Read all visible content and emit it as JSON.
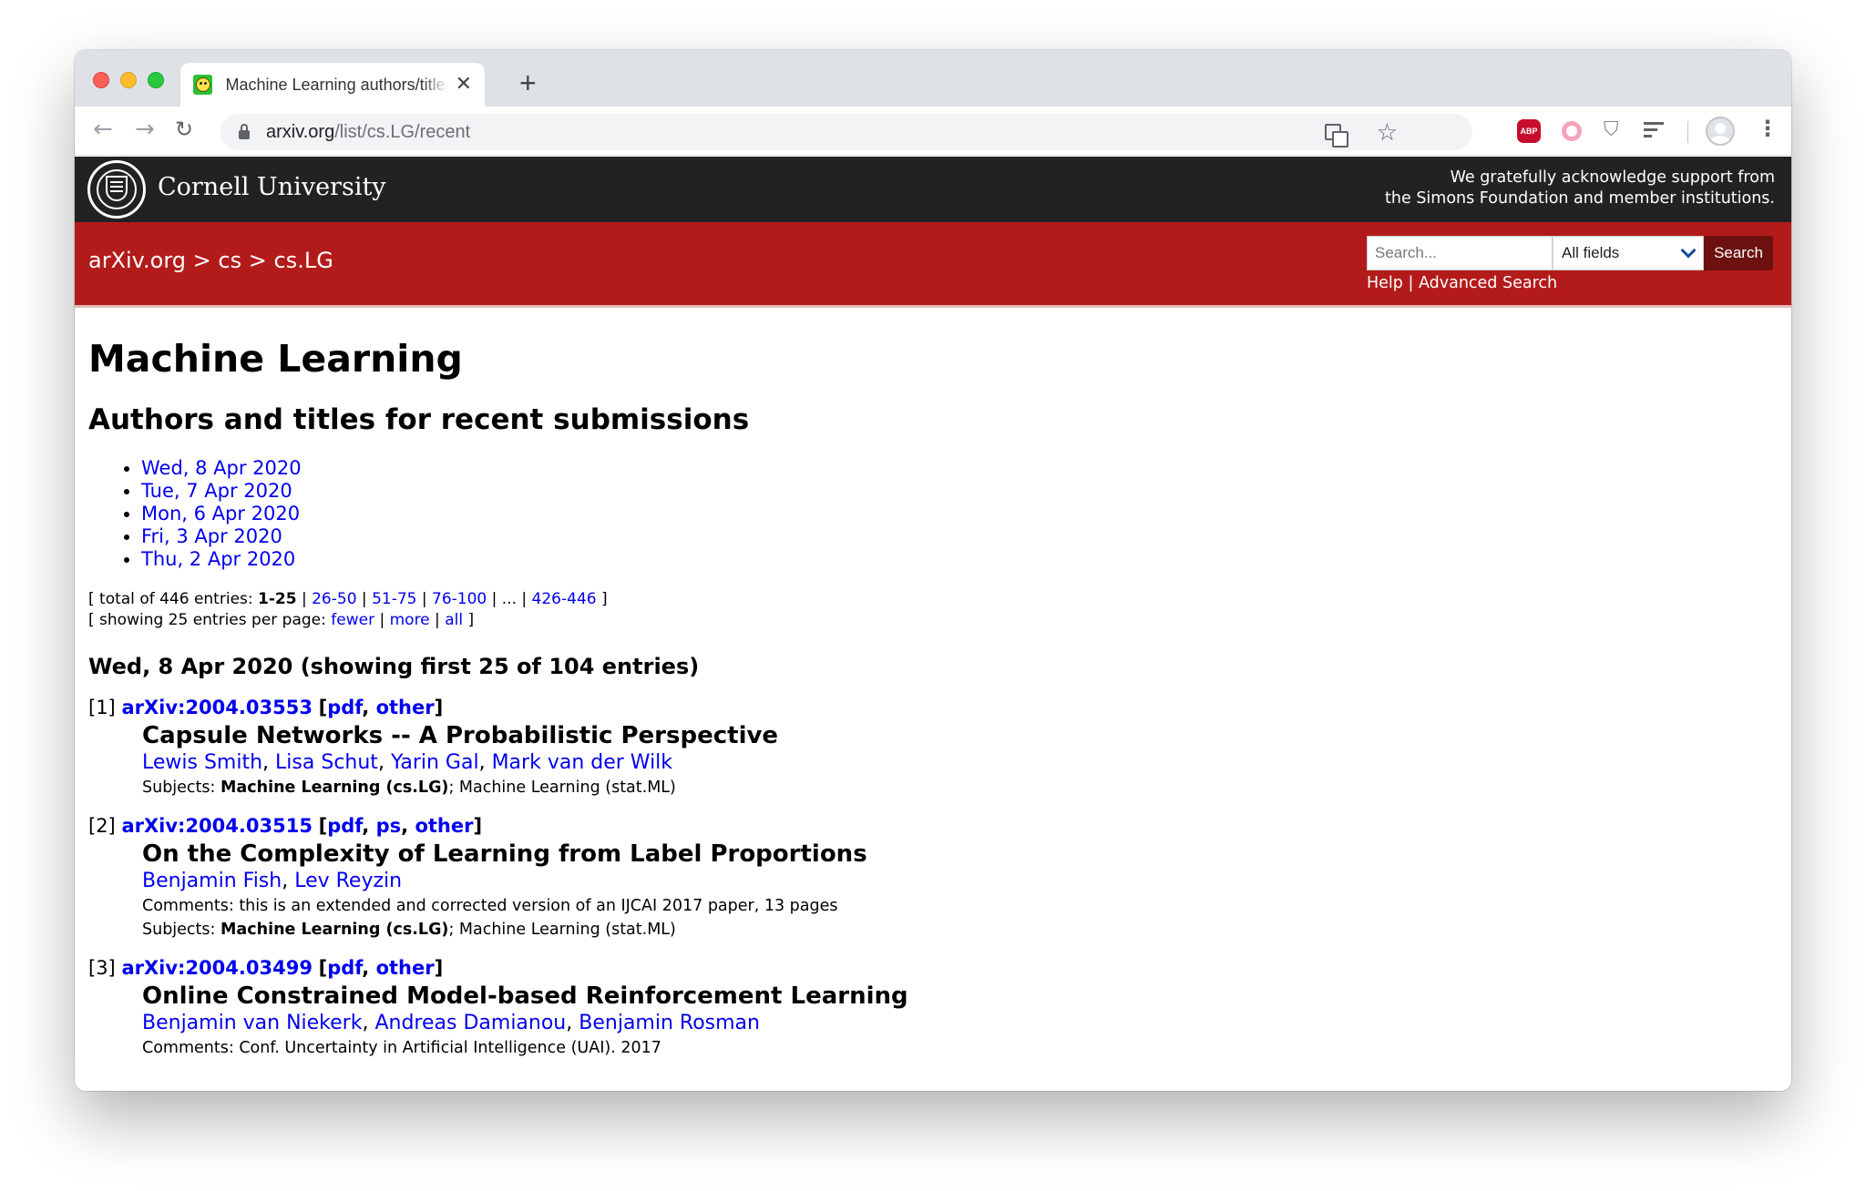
{
  "browser": {
    "tab_title": "Machine Learning authors/titles recent submissions",
    "new_tab": "+",
    "url_host": "arxiv.org",
    "url_path": "/list/cs.LG/recent",
    "abp_label": "ABP"
  },
  "header": {
    "university": "Cornell University",
    "ack_line1": "We gratefully acknowledge support from",
    "ack_line2": "the Simons Foundation and member institutions."
  },
  "nav": {
    "crumb_home": "arXiv.org",
    "sep": ">",
    "crumb_cs": "cs",
    "crumb_lg": "cs.LG",
    "search_placeholder": "Search...",
    "field_selected": "All fields",
    "search_button": "Search",
    "help": "Help",
    "pipe": "|",
    "advanced": "Advanced Search"
  },
  "page": {
    "title": "Machine Learning",
    "subtitle": "Authors and titles for recent submissions",
    "days": [
      "Wed, 8 Apr 2020",
      "Tue, 7 Apr 2020",
      "Mon, 6 Apr 2020",
      "Fri, 3 Apr 2020",
      "Thu, 2 Apr 2020"
    ],
    "pager": {
      "total_prefix": "[ total of 446 entries: ",
      "current": "1-25",
      "pages": [
        "26-50",
        "51-75",
        "76-100"
      ],
      "ellipsis": "...",
      "last": "426-446",
      "close": " ]",
      "showing_prefix": "[ showing 25 entries per page: ",
      "fewer": "fewer",
      "more": "more",
      "all": "all"
    },
    "day_heading": "Wed, 8 Apr 2020 (showing first 25 of 104 entries)"
  },
  "entries": [
    {
      "num": "[1]",
      "id": "arXiv:2004.03553",
      "formats": [
        "pdf",
        "other"
      ],
      "title": "Capsule Networks -- A Probabilistic Perspective",
      "authors": [
        "Lewis Smith",
        "Lisa Schut",
        "Yarin Gal",
        "Mark van der Wilk"
      ],
      "comments": "",
      "subjects_label": "Subjects:",
      "subjects_primary": "Machine Learning (cs.LG)",
      "subjects_rest": "; Machine Learning (stat.ML)"
    },
    {
      "num": "[2]",
      "id": "arXiv:2004.03515",
      "formats": [
        "pdf",
        "ps",
        "other"
      ],
      "title": "On the Complexity of Learning from Label Proportions",
      "authors": [
        "Benjamin Fish",
        "Lev Reyzin"
      ],
      "comments": "Comments: this is an extended and corrected version of an IJCAI 2017 paper, 13 pages",
      "subjects_label": "Subjects:",
      "subjects_primary": "Machine Learning (cs.LG)",
      "subjects_rest": "; Machine Learning (stat.ML)"
    },
    {
      "num": "[3]",
      "id": "arXiv:2004.03499",
      "formats": [
        "pdf",
        "other"
      ],
      "title": "Online Constrained Model-based Reinforcement Learning",
      "authors": [
        "Benjamin van Niekerk",
        "Andreas Damianou",
        "Benjamin Rosman"
      ],
      "comments": "Comments: Conf. Uncertainty in Artificial Intelligence (UAI). 2017",
      "subjects_label": "",
      "subjects_primary": "",
      "subjects_rest": ""
    }
  ]
}
